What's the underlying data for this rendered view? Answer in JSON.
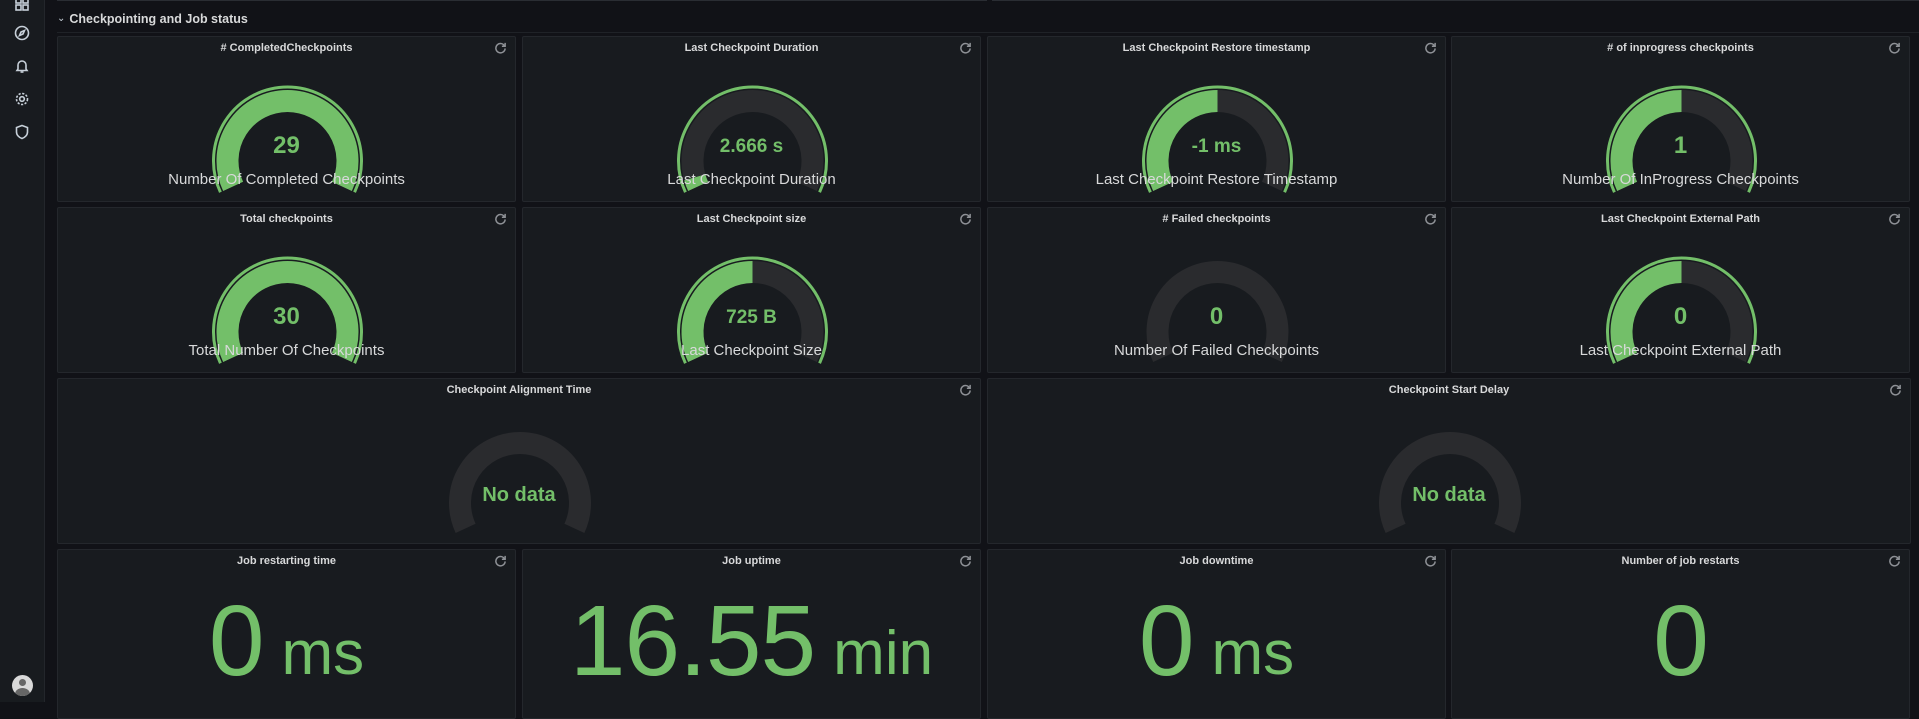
{
  "sidebar": {
    "icons": [
      "dashboards-icon",
      "explore-icon",
      "alerting-icon",
      "configuration-icon",
      "shield-icon"
    ]
  },
  "row": {
    "title": "Checkpointing and Job status"
  },
  "colors": {
    "accent_green": "#73bf69",
    "track": "#2a2b2e",
    "panel_bg": "#181b1f"
  },
  "gauges": [
    {
      "title": "# CompletedCheckpoints",
      "label": "Number Of Completed Checkpoints",
      "value": "29",
      "fill": 1.0,
      "thresholds": "full"
    },
    {
      "title": "Last Checkpoint Duration",
      "label": "Last Checkpoint Duration",
      "value": "2.666 s",
      "fill": 0.04
    },
    {
      "title": "Last Checkpoint Restore timestamp",
      "label": "Last Checkpoint Restore Timestamp",
      "value": "-1 ms",
      "fill": 0.5
    },
    {
      "title": "# of inprogress checkpoints",
      "label": "Number Of InProgress Checkpoints",
      "value": "1",
      "fill": 0.5
    },
    {
      "title": "Total checkpoints",
      "label": "Total Number Of Checkpoints",
      "value": "30",
      "fill": 1.0
    },
    {
      "title": "Last Checkpoint size",
      "label": "Last Checkpoint Size",
      "value": "725 B",
      "fill": 0.5
    },
    {
      "title": "# Failed checkpoints",
      "label": "Number Of Failed Checkpoints",
      "value": "0",
      "fill": 0.0
    },
    {
      "title": "Last Checkpoint External Path",
      "label": "Last Checkpoint External Path",
      "value": "0",
      "fill": 0.5
    }
  ],
  "wide_gauges": [
    {
      "title": "Checkpoint Alignment Time",
      "value": "No data"
    },
    {
      "title": "Checkpoint Start Delay",
      "value": "No data"
    }
  ],
  "stats": [
    {
      "title": "Job restarting time",
      "value": "0",
      "unit": "ms"
    },
    {
      "title": "Job uptime",
      "value": "16.55",
      "unit": "min"
    },
    {
      "title": "Job downtime",
      "value": "0",
      "unit": "ms"
    },
    {
      "title": "Number of job restarts",
      "value": "0",
      "unit": ""
    }
  ]
}
